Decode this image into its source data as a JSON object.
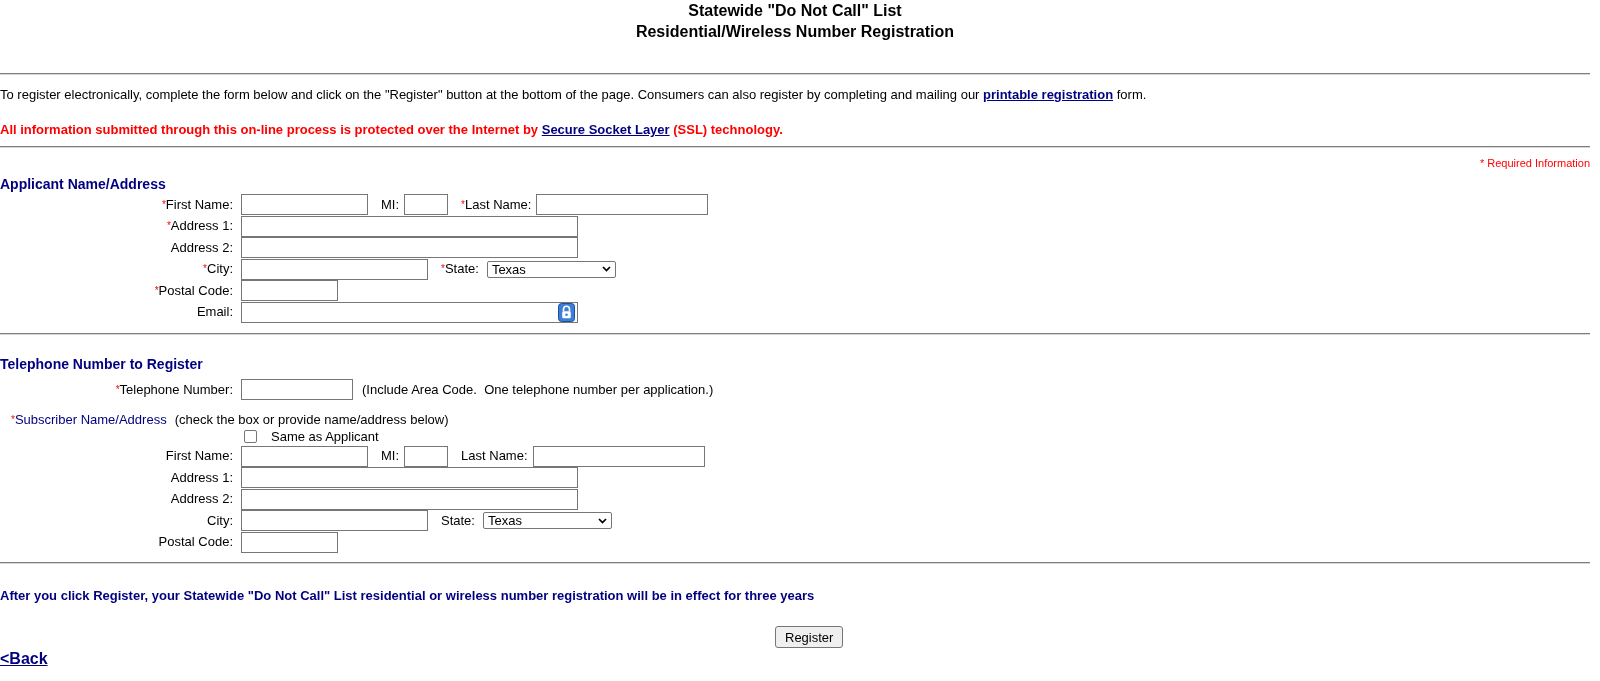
{
  "header": {
    "title_lines": [
      "Statewide \"Do Not Call\" List",
      "Residential/Wireless Number Registration"
    ]
  },
  "intro": {
    "segments": [
      {
        "kind": "text",
        "text": "To register electronically, complete the form below and click on the \"Register\" button at the bottom of the page. Consumers can also register by completing and mailing our "
      },
      {
        "kind": "link",
        "text": "printable registration"
      },
      {
        "kind": "text",
        "text": " form."
      }
    ]
  },
  "security_notice": {
    "segments": [
      {
        "kind": "text",
        "text": "All information submitted through this on-line process is protected over the Internet by "
      },
      {
        "kind": "link",
        "text": "Secure Socket Layer"
      },
      {
        "kind": "text",
        "text": " (SSL) technology."
      }
    ]
  },
  "required_note": "* Required Information",
  "applicant": {
    "heading": "Applicant Name/Address",
    "fields": [
      {
        "kind": "name",
        "mark": "*",
        "label": "First Name:",
        "inline": [
          {
            "kind": "initial",
            "label": "MI:"
          },
          {
            "kind": "surname",
            "mark": "*",
            "label": "Last Name:"
          }
        ]
      },
      {
        "kind": "address",
        "mark": "*",
        "label": "Address 1:"
      },
      {
        "kind": "address",
        "label": "Address 2:"
      },
      {
        "kind": "city",
        "mark": "*",
        "label": "City:",
        "inline": [
          {
            "kind": "state",
            "mark": "*",
            "label": "State:",
            "value": "Texas"
          }
        ]
      },
      {
        "kind": "postal",
        "mark": "*",
        "label": "Postal Code:"
      },
      {
        "kind": "email",
        "label": "Email:"
      }
    ]
  },
  "telephone": {
    "heading": "Telephone Number to Register",
    "phone": {
      "kind": "phone",
      "mark": "*",
      "label": "Telephone Number:",
      "note": "(Include Area Code.  One telephone number per application.)"
    },
    "subscriber": {
      "mark": "*",
      "label": "Subscriber Name/Address",
      "hint": "(check the box or provide name/address below)",
      "same_as_applicant": {
        "label": "Same as Applicant",
        "checked": false
      },
      "fields": [
        {
          "kind": "name",
          "label": "First Name:",
          "inline": [
            {
              "kind": "initial",
              "label": "MI:"
            },
            {
              "kind": "surname",
              "label": "Last Name:"
            }
          ]
        },
        {
          "kind": "address",
          "label": "Address 1:"
        },
        {
          "kind": "address",
          "label": "Address 2:"
        },
        {
          "kind": "city",
          "label": "City:",
          "inline": [
            {
              "kind": "state",
              "label": "State:",
              "value": "Texas"
            }
          ]
        },
        {
          "kind": "postal",
          "label": "Postal Code:"
        }
      ]
    }
  },
  "footer": {
    "notice": "After you click Register, your Statewide \"Do Not Call\" List residential or wireless number registration will be in effect for three years",
    "register_button": "Register",
    "back_link": "<Back"
  }
}
